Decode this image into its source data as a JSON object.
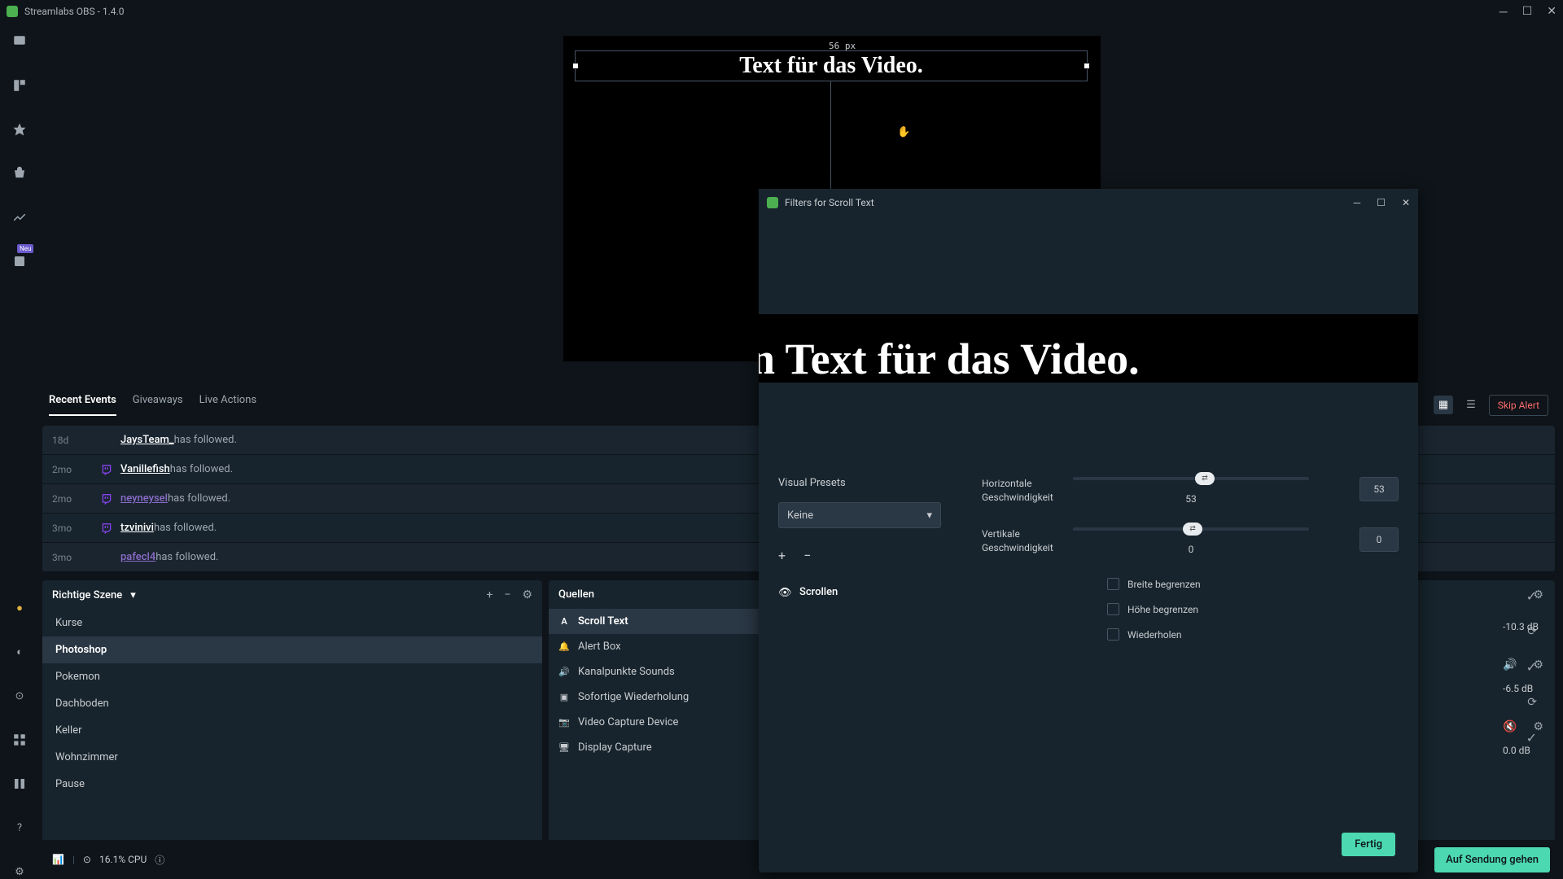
{
  "titlebar": {
    "title": "Streamlabs OBS - 1.4.0"
  },
  "preview": {
    "px_label": "56 px",
    "source_text": "Text für das Video."
  },
  "filters_dialog": {
    "title": "Filters for Scroll Text",
    "preview_text": "n Text für das Video.",
    "visual_presets_label": "Visual Presets",
    "preset_value": "Keine",
    "filter_name": "Scrollen",
    "h_speed_label": "Horizontale Geschwindigkeit",
    "h_speed_value": "53",
    "h_speed_input": "53",
    "v_speed_label": "Vertikale Geschwindigkeit",
    "v_speed_value": "0",
    "v_speed_input": "0",
    "cb_width": "Breite begrenzen",
    "cb_height": "Höhe begrenzen",
    "cb_repeat": "Wiederholen",
    "done": "Fertig"
  },
  "tabs": {
    "recent": "Recent Events",
    "giveaways": "Giveaways",
    "live": "Live Actions",
    "skip": "Skip Alert"
  },
  "events": [
    {
      "time": "18d",
      "user": "JaysTeam_",
      "action": " has followed.",
      "alt": false,
      "clicked": false,
      "twitch": false
    },
    {
      "time": "2mo",
      "user": "Vanillefish",
      "action": " has followed.",
      "alt": true,
      "clicked": false,
      "twitch": true
    },
    {
      "time": "2mo",
      "user": "neyneysel",
      "action": " has followed.",
      "alt": false,
      "clicked": true,
      "twitch": true
    },
    {
      "time": "3mo",
      "user": "tzvinivi",
      "action": " has followed.",
      "alt": true,
      "clicked": false,
      "twitch": true
    },
    {
      "time": "3mo",
      "user": "pafecl4",
      "action": " has followed.",
      "alt": false,
      "clicked": true,
      "twitch": false
    }
  ],
  "scenes": {
    "title": "Richtige Szene",
    "items": [
      "Kurse",
      "Photoshop",
      "Pokemon",
      "Dachboden",
      "Keller",
      "Wohnzimmer",
      "Pause"
    ],
    "active": "Photoshop"
  },
  "sources": {
    "title": "Quellen",
    "items": [
      {
        "icon": "A",
        "label": "Scroll Text",
        "active": true
      },
      {
        "icon": "🔔",
        "label": "Alert Box",
        "active": false
      },
      {
        "icon": "🔊",
        "label": "Kanalpunkte Sounds",
        "active": false
      },
      {
        "icon": "▣",
        "label": "Sofortige Wiederholung",
        "active": false
      },
      {
        "icon": "📷",
        "label": "Video Capture Device",
        "active": false
      },
      {
        "icon": "🖥",
        "label": "Display Capture",
        "active": false
      }
    ]
  },
  "mixer": {
    "db1": "-10.3 dB",
    "db2": "-6.5 dB",
    "db3": "0.0 dB"
  },
  "bottombar": {
    "cpu": "16.1% CPU",
    "golive": "Auf Sendung gehen"
  }
}
